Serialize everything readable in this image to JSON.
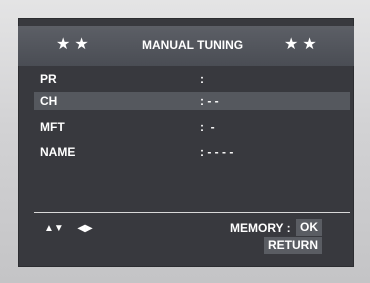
{
  "header": {
    "stars_left": "★★",
    "title": "MANUAL TUNING",
    "stars_right": "★★"
  },
  "rows": [
    {
      "label": "PR",
      "value": ":"
    },
    {
      "label": "CH",
      "value": ": - -"
    },
    {
      "label": "MFT",
      "value": ":  -"
    },
    {
      "label": "NAME",
      "value": ": - - - -"
    }
  ],
  "footer": {
    "nav_up_down": "▲▼",
    "nav_left_right": "◀▶",
    "memory_label": "MEMORY :",
    "ok_label": "OK",
    "return_label": "RETURN"
  },
  "colors": {
    "screen_bg": "#38393e",
    "header_bg": "#4a4d54",
    "highlight_bg": "#55585e",
    "button_bg": "#5a5d63",
    "text": "#ffffff"
  }
}
